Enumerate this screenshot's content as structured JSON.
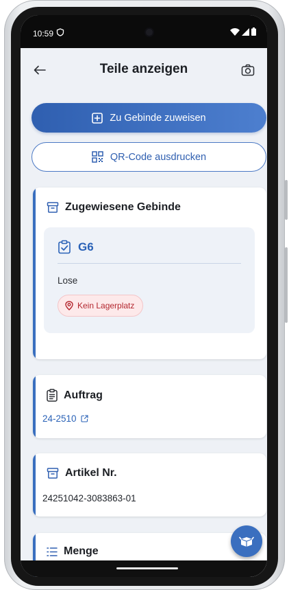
{
  "status_bar": {
    "time": "10:59"
  },
  "app_bar": {
    "title": "Teile anzeigen"
  },
  "actions": {
    "assign_label": "Zu Gebinde zuweisen",
    "print_qr_label": "QR-Code ausdrucken"
  },
  "assigned": {
    "heading": "Zugewiesene Gebinde",
    "container": {
      "name": "G6",
      "type": "Lose",
      "location_badge": "Kein Lagerplatz"
    }
  },
  "order": {
    "heading": "Auftrag",
    "value": "24-2510"
  },
  "article": {
    "heading": "Artikel Nr.",
    "value": "24251042-3083863-01"
  },
  "quantity": {
    "heading": "Menge"
  },
  "colors": {
    "accent": "#3a6fbf",
    "link": "#2a62b7",
    "badge_text": "#b3262e",
    "badge_bg": "#fde9ea"
  },
  "icons": {
    "back": "arrow-left-icon",
    "camera": "camera-icon",
    "assign": "plus-square-icon",
    "qr": "qr-code-icon",
    "archive": "archive-box-icon",
    "clipboard": "clipboard-check-icon",
    "location": "map-pin-icon",
    "order": "clipboard-text-icon",
    "external": "external-link-icon",
    "list": "list-icon",
    "fab": "package-icon"
  }
}
